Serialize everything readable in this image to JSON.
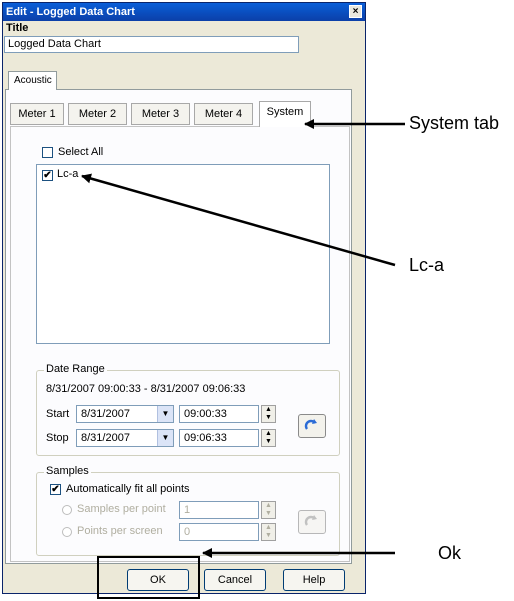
{
  "window": {
    "title": "Edit - Logged Data Chart",
    "close_glyph": "×"
  },
  "title_field": {
    "label": "Title",
    "value": "Logged Data Chart"
  },
  "outer_tab": {
    "label": "Acoustic"
  },
  "inner_tabs": [
    {
      "label": "Meter 1"
    },
    {
      "label": "Meter 2"
    },
    {
      "label": "Meter 3"
    },
    {
      "label": "Meter 4"
    },
    {
      "label": "System",
      "active": true
    }
  ],
  "select_all": {
    "label": "Select All",
    "checked": false
  },
  "list_items": [
    {
      "label": "Lc-a",
      "checked": true
    }
  ],
  "date_range": {
    "title": "Date Range",
    "range_text": "8/31/2007 09:00:33 - 8/31/2007 09:06:33",
    "start_label": "Start",
    "start_date": "8/31/2007",
    "start_time": "09:00:33",
    "stop_label": "Stop",
    "stop_date": "8/31/2007",
    "stop_time": "09:06:33"
  },
  "samples": {
    "title": "Samples",
    "auto_fit_label": "Automatically fit all points",
    "auto_fit_checked": true,
    "samples_per_point_label": "Samples per point",
    "samples_per_point_value": "1",
    "points_per_screen_label": "Points per screen",
    "points_per_screen_value": "0"
  },
  "buttons": {
    "ok": "OK",
    "cancel": "Cancel",
    "help": "Help"
  },
  "callouts": {
    "system_tab": "System tab",
    "lc_a": "Lc-a",
    "ok": "Ok"
  },
  "colors": {
    "titlebar": "#0b3fa8",
    "dialog_bg": "#ece9d8",
    "panel_bg": "#fcfcfe"
  }
}
